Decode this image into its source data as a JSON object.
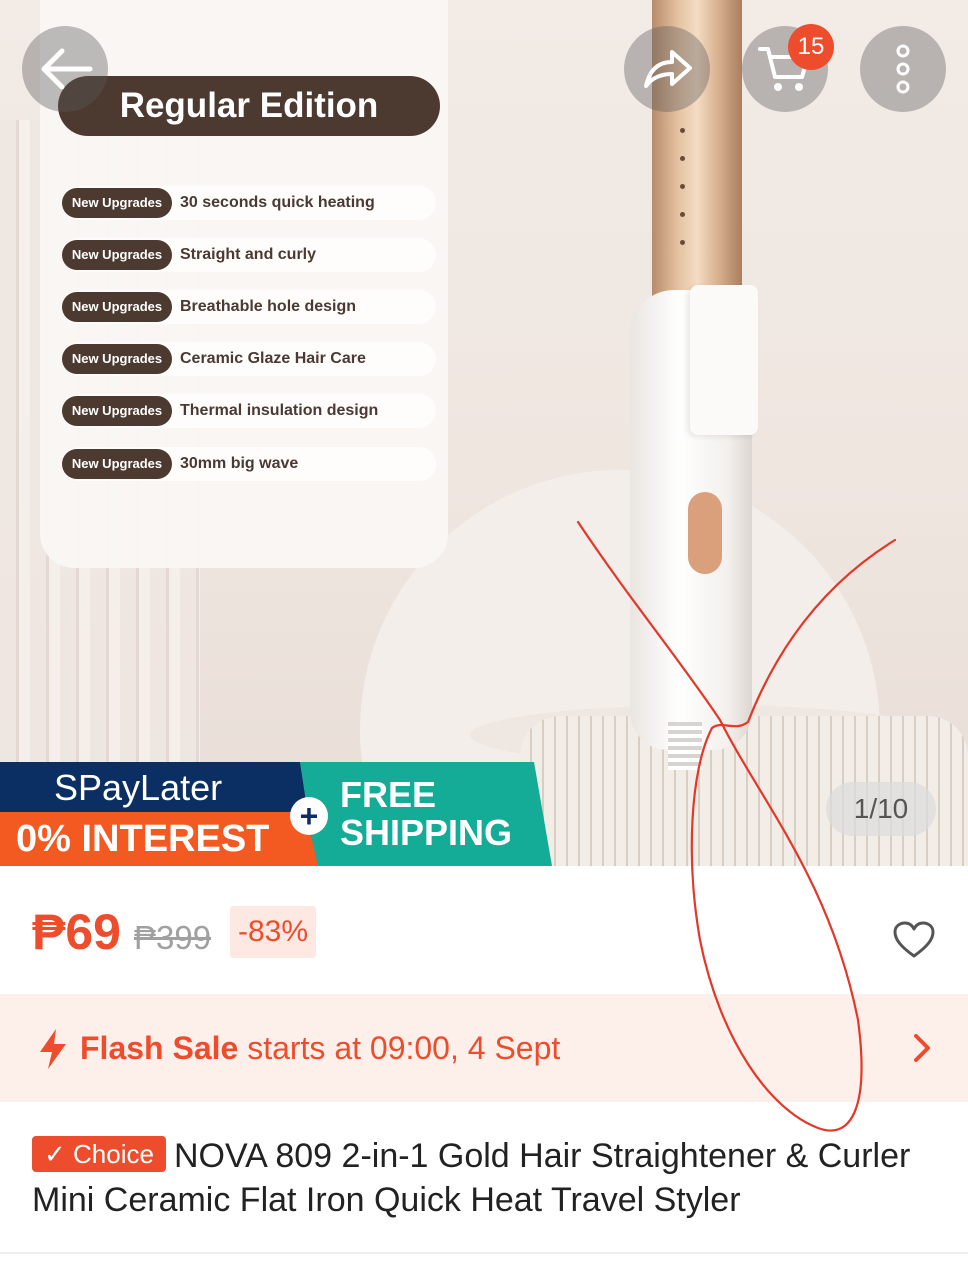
{
  "hero": {
    "edition_label": "Regular Edition",
    "feature_badge": "New Upgrades",
    "features": [
      "30 seconds quick heating",
      "Straight and curly",
      "Breathable hole design",
      "Ceramic Glaze Hair Care",
      "Thermal insulation design",
      "30mm big wave"
    ],
    "promo": {
      "spaylater": "SPayLater",
      "interest": "0% INTEREST",
      "free": "FREE",
      "shipping": "SHIPPING",
      "plus": "+"
    },
    "image_counter": "1/10"
  },
  "header": {
    "cart_count": "15",
    "icons": [
      "back-arrow-icon",
      "share-icon",
      "cart-icon",
      "more-icon"
    ]
  },
  "price": {
    "current": "₱69",
    "original": "₱399",
    "discount": "-83%"
  },
  "flash_sale": {
    "label": "Flash Sale",
    "schedule": " starts at 09:00, 4 Sept"
  },
  "product": {
    "badge": "✓ Choice",
    "title": "NOVA 809 2-in-1 Gold Hair Straightener & Curler Mini Ceramic Flat Iron Quick Heat Travel Styler"
  },
  "colors": {
    "accent": "#ee4d2d",
    "promo_navy": "#0b2e63",
    "promo_teal": "#14ab97",
    "edition_brown": "#4c3a30"
  }
}
